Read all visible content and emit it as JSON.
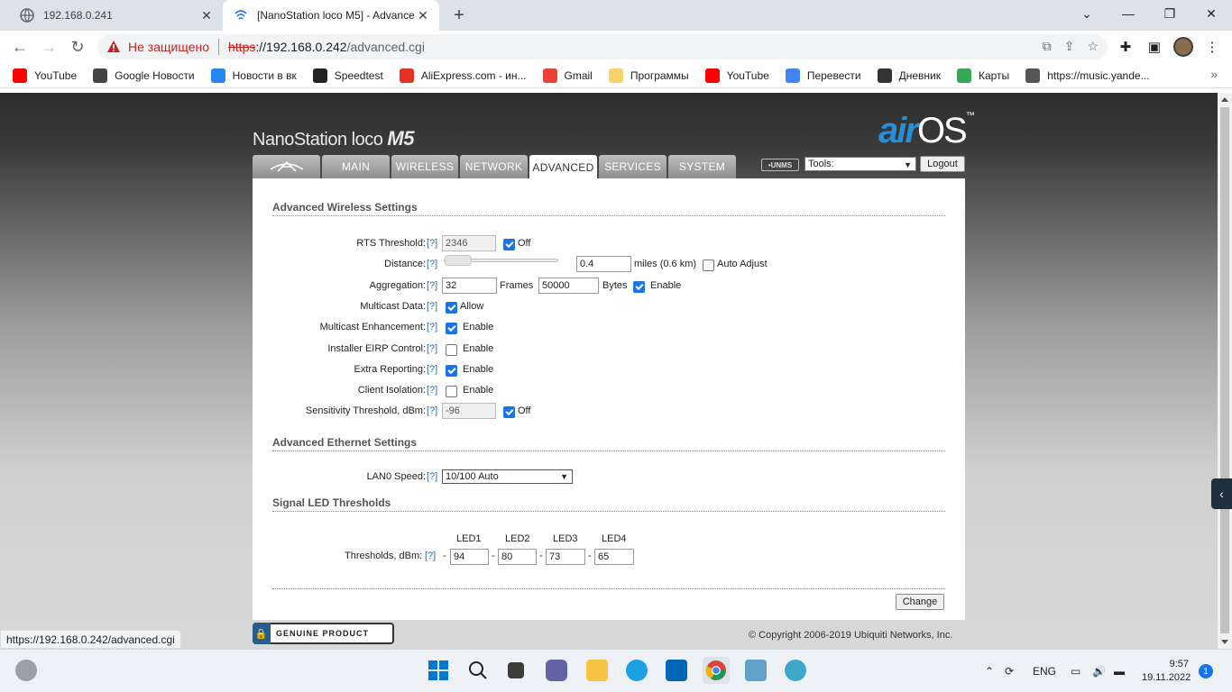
{
  "browser": {
    "tabs": [
      {
        "title": "192.168.0.241",
        "active": false
      },
      {
        "title": "[NanoStation loco M5] - Advanced",
        "active": true
      }
    ],
    "address": {
      "security_label": "Не защищено",
      "scheme": "https",
      "host": "://192.168.0.242",
      "path": "/advanced.cgi"
    },
    "bookmarks": [
      {
        "label": "YouTube",
        "icon": "youtube-icon",
        "color": "#ff0000"
      },
      {
        "label": "Google Новости",
        "icon": "google-news-icon",
        "color": "#444444"
      },
      {
        "label": "Новости в вк",
        "icon": "vk-icon",
        "color": "#2787f5"
      },
      {
        "label": "Speedtest",
        "icon": "speedtest-icon",
        "color": "#222222"
      },
      {
        "label": "AliExpress.com - ин...",
        "icon": "aliexpress-icon",
        "color": "#e43225"
      },
      {
        "label": "Gmail",
        "icon": "gmail-icon",
        "color": "#ea4335"
      },
      {
        "label": "Программы",
        "icon": "folder-icon",
        "color": "#f6d36b"
      },
      {
        "label": "YouTube",
        "icon": "youtube-icon",
        "color": "#ff0000"
      },
      {
        "label": "Перевести",
        "icon": "translate-icon",
        "color": "#4285f4"
      },
      {
        "label": "Дневник",
        "icon": "diary-icon",
        "color": "#333333"
      },
      {
        "label": "Карты",
        "icon": "maps-icon",
        "color": "#34a853"
      },
      {
        "label": "https://music.yande...",
        "icon": "music-icon",
        "color": "#555555"
      }
    ],
    "status_url": "https://192.168.0.242/advanced.cgi"
  },
  "airos": {
    "product": {
      "name": "NanoStation",
      "model": "loco",
      "series": "M5"
    },
    "brand": {
      "air": "air",
      "os": "OS",
      "tm": "™"
    },
    "nav_tabs": [
      "MAIN",
      "WIRELESS",
      "NETWORK",
      "ADVANCED",
      "SERVICES",
      "SYSTEM"
    ],
    "active_tab": "ADVANCED",
    "unms_label": "UNMS",
    "tools_value": "Tools:",
    "logout_label": "Logout",
    "help": "[?]",
    "sections": {
      "wireless": "Advanced Wireless Settings",
      "ethernet": "Advanced Ethernet Settings",
      "led": "Signal LED Thresholds"
    },
    "wireless": {
      "rts": {
        "label": "RTS Threshold:",
        "value": "2346",
        "off_checked": true,
        "off_label": "Off"
      },
      "distance": {
        "label": "Distance:",
        "value": "0.4",
        "unit": "miles (0.6 km)",
        "auto_checked": false,
        "auto_label": "Auto Adjust"
      },
      "aggregation": {
        "label": "Aggregation:",
        "frames": "32",
        "frames_label": "Frames",
        "bytes": "50000",
        "bytes_label": "Bytes",
        "enable_checked": true,
        "enable_label": "Enable"
      },
      "multicast_data": {
        "label": "Multicast Data:",
        "checked": true,
        "opt": "Allow"
      },
      "multicast_enh": {
        "label": "Multicast Enhancement:",
        "checked": true,
        "opt": "Enable"
      },
      "installer_eirp": {
        "label": "Installer EIRP Control:",
        "checked": false,
        "opt": "Enable"
      },
      "extra_reporting": {
        "label": "Extra Reporting:",
        "checked": true,
        "opt": "Enable"
      },
      "client_isolation": {
        "label": "Client Isolation:",
        "checked": false,
        "opt": "Enable"
      },
      "sensitivity": {
        "label": "Sensitivity Threshold, dBm:",
        "value": "-96",
        "off_checked": true,
        "off_label": "Off"
      }
    },
    "ethernet": {
      "lan0_label": "LAN0 Speed:",
      "lan0_value": "10/100 Auto"
    },
    "led": {
      "label": "Thresholds, dBm:",
      "headers": [
        "LED1",
        "LED2",
        "LED3",
        "LED4"
      ],
      "values": [
        "94",
        "80",
        "73",
        "65"
      ],
      "minus": "-"
    },
    "change_label": "Change",
    "genuine_label": "GENUINE PRODUCT",
    "copyright": "© Copyright 2006-2019 Ubiquiti Networks, Inc."
  },
  "taskbar": {
    "lang": "ENG",
    "time": "9:57",
    "date": "19.11.2022",
    "notifications": "1"
  }
}
